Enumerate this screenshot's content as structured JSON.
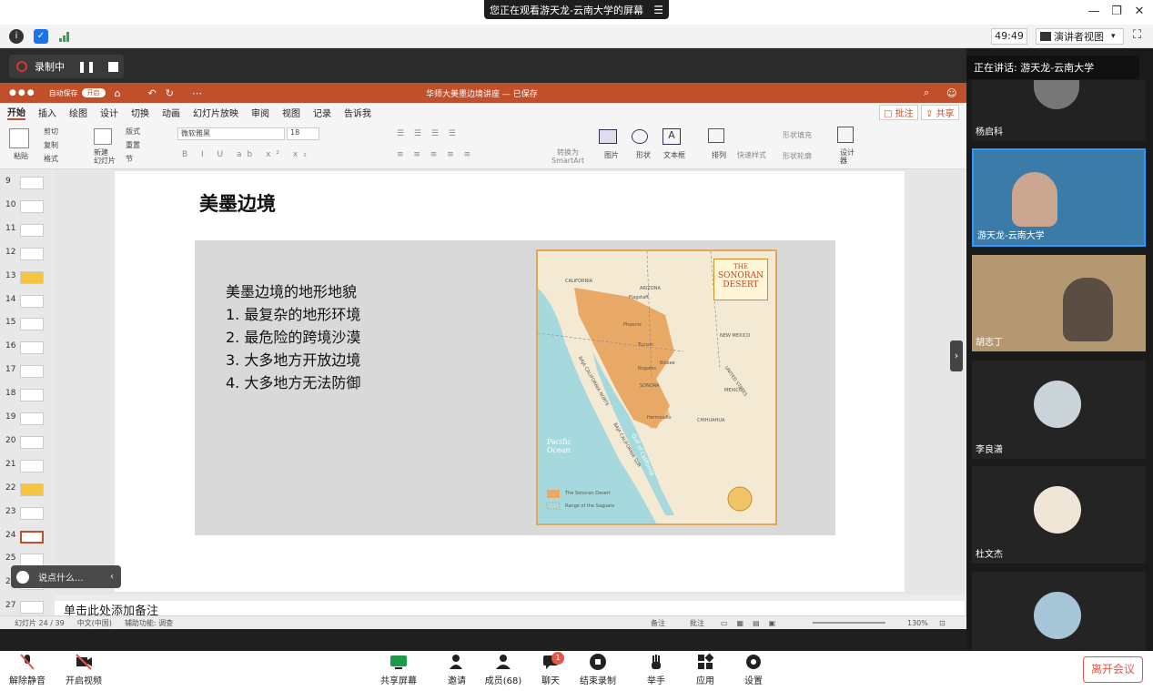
{
  "banner": {
    "text": "您正在观看游天龙-云南大学的屏幕",
    "menu_icon": "menu-icon"
  },
  "window_controls": {
    "min": "—",
    "restore": "❐",
    "close": "✕"
  },
  "status": {
    "timer": "49:49",
    "presenter_view": "演讲者视图",
    "presenter_caret": "▾"
  },
  "recording": {
    "label": "录制中"
  },
  "ppt": {
    "autosave": "自动保存",
    "autosave_toggle": "开启",
    "doc_title": "华师大美墨边境讲座 — 已保存",
    "menu": [
      "开始",
      "插入",
      "绘图",
      "设计",
      "切换",
      "动画",
      "幻灯片放映",
      "审阅",
      "视图",
      "记录",
      "告诉我"
    ],
    "comment_btn": "批注",
    "share_btn": "共享",
    "ribbon": {
      "paste": "粘贴",
      "cut": "剪切",
      "copy": "复制",
      "format": "格式",
      "new_slide": "新建\n幻灯片",
      "layout": "版式",
      "reset": "重置",
      "section": "节",
      "font_name": "微软雅黑",
      "font_size": "18",
      "smartart": "转换为\nSmartArt",
      "picture": "图片",
      "shape": "形状",
      "textbox": "文本框",
      "arrange": "排列",
      "quick_styles": "快速样式",
      "shape_fill": "形状填充",
      "shape_outline": "形状轮廓",
      "designer": "设计\n器"
    },
    "thumbnails": [
      "9",
      "10",
      "11",
      "12",
      "13",
      "14",
      "15",
      "16",
      "17",
      "18",
      "19",
      "20",
      "21",
      "22",
      "23",
      "24",
      "25",
      "26",
      "27"
    ],
    "slide": {
      "title": "美墨边境",
      "heading": "美墨边境的地形地貌",
      "bullets": [
        "1.  最复杂的地形环境",
        "2.  最危险的跨境沙漠",
        "3.  大多地方开放边境",
        "4.  大多地方无法防御"
      ],
      "map": {
        "title_line1": "THE",
        "title_line2": "SONORAN",
        "title_line3": "DESERT",
        "labels": [
          "CALIFORNIA",
          "ARIZONA",
          "Flagstaff",
          "Phoenix",
          "Tucson",
          "Nogales",
          "Bisbee",
          "SONORA",
          "Hermosillo",
          "NEW MEXICO",
          "UNITED STATES",
          "MEXICO",
          "CHIHUAHUA",
          "BAJA CALIFORNIA NORTE",
          "BAJA CALIFORNIA SUR",
          "Gulf of California",
          "Pacific Ocean"
        ],
        "legend": [
          "The Sonoran Desert",
          "Range of the Saguaro"
        ]
      }
    },
    "comment_placeholder": "说点什么...",
    "notes_placeholder": "单击此处添加备注",
    "status_left": "幻灯片 24 / 39",
    "status_lang": "中文(中国)",
    "status_access": "辅助功能: 调查",
    "status_notes": "备注",
    "status_comments": "批注",
    "zoom": "130%"
  },
  "meeting": {
    "speaking_label": "正在讲话: 游天龙-云南大学",
    "participants": [
      {
        "name": "杨启科"
      },
      {
        "name": "游天龙-云南大学"
      },
      {
        "name": "胡志丁"
      },
      {
        "name": "李良潇"
      },
      {
        "name": "杜文杰"
      }
    ]
  },
  "toolbar": {
    "unmute": "解除静音",
    "start_video": "开启视频",
    "share_screen": "共享屏幕",
    "invite": "邀请",
    "members": "成员(68)",
    "chat": "聊天",
    "chat_badge": "1",
    "stop_record": "结束录制",
    "raise_hand": "举手",
    "apps": "应用",
    "settings": "设置",
    "leave": "离开会议"
  },
  "colors": {
    "ppt_accent": "#c0502b",
    "leave": "#e5564a",
    "desert": "#e8a866"
  }
}
